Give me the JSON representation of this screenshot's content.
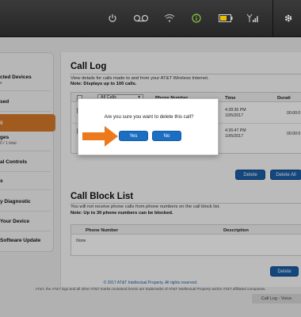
{
  "sidebar": {
    "items": [
      {
        "label": "cted Devices",
        "sub": "s"
      },
      {
        "label": "sed",
        "sub": ""
      },
      {
        "label": "ll",
        "sub": ""
      },
      {
        "label": "ges",
        "sub": "0 / 1 total"
      },
      {
        "label": "al Controls",
        "sub": ""
      },
      {
        "label": "s",
        "sub": ""
      },
      {
        "label": "y Diagnostic",
        "sub": ""
      },
      {
        "label": "Your Device",
        "sub": ""
      },
      {
        "label": "Software Update",
        "sub": ""
      }
    ]
  },
  "call_log": {
    "title": "Call Log",
    "desc": "View details for calls made to and from your AT&T Wireless Internet.",
    "note": "Note: Displays up to 100 calls.",
    "filter_value": "All Calls",
    "columns": [
      "Phone Number",
      "Time",
      "Durati"
    ],
    "rows": [
      {
        "time_line1": "4:28:36 PM",
        "time_line2": "10/5/2017",
        "duration": "00:00:0"
      },
      {
        "time_line1": "4:26:47 PM",
        "time_line2": "10/5/2017",
        "duration": "00:00:0"
      }
    ],
    "delete_label": "Delete",
    "delete_all_label": "Delete All"
  },
  "call_block": {
    "title": "Call Block List",
    "desc": "You will not receive phone calls from phone numbers on the call block list.",
    "note": "Note: Up to 30 phone numbers can be blocked.",
    "columns": [
      "Phone Number",
      "Description"
    ],
    "empty": "None",
    "delete_label": "Delete"
  },
  "footer": {
    "copyright": "© 2017 AT&T Intellectual Property. All rights reserved.",
    "trademark": "AT&T, the AT&T logo and all other AT&T marks contained herein are trademarks of AT&T Intellectual Property and/or AT&T affiliated companies.",
    "tag": "Call Log - Voice"
  },
  "modal": {
    "message": "Are you sure you want to delete this call?",
    "yes_label": "Yes",
    "no_label": "No"
  },
  "colors": {
    "accent": "#d87a2a",
    "button": "#1b5fa8",
    "arrow": "#ec7a1c"
  },
  "icons": [
    "power-icon",
    "voicemail-icon",
    "wifi-icon",
    "info-icon",
    "battery-icon",
    "signal-icon",
    "settings-icon"
  ]
}
